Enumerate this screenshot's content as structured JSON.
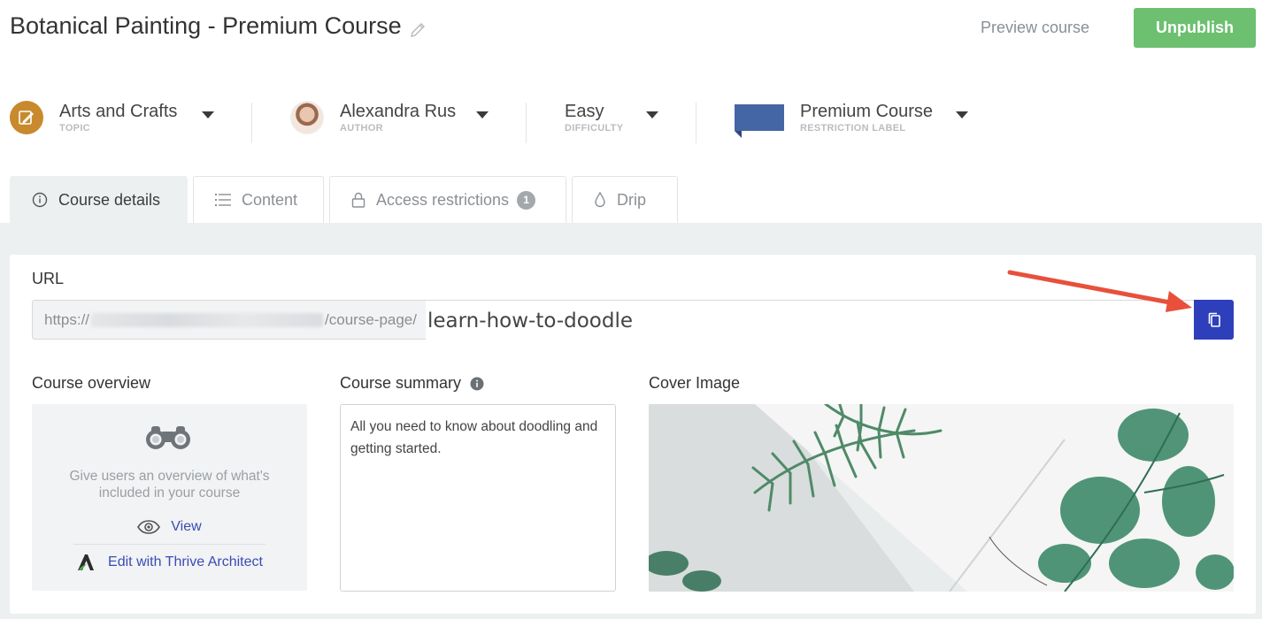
{
  "header": {
    "title": "Botanical Painting - Premium Course",
    "preview_label": "Preview course",
    "unpublish_label": "Unpublish"
  },
  "meta": {
    "topic": {
      "value": "Arts and Crafts",
      "label": "TOPIC",
      "icon": "paintbrush-icon"
    },
    "author": {
      "value": "Alexandra Rus",
      "label": "AUTHOR"
    },
    "difficulty": {
      "value": "Easy",
      "label": "DIFFICULTY"
    },
    "restriction": {
      "value": "Premium Course",
      "label": "RESTRICTION LABEL",
      "color": "#4566a4"
    }
  },
  "tabs": [
    {
      "label": "Course details",
      "icon": "info-icon",
      "active": true
    },
    {
      "label": "Content",
      "icon": "list-icon"
    },
    {
      "label": "Access restrictions",
      "icon": "lock-icon",
      "badge": "1"
    },
    {
      "label": "Drip",
      "icon": "drop-icon"
    }
  ],
  "url": {
    "label": "URL",
    "prefix": "https://",
    "path": "/course-page/",
    "slug": "learn-how-to-doodle"
  },
  "overview": {
    "label": "Course overview",
    "text": "Give users an overview of what's included in your course",
    "view_label": "View",
    "edit_label": "Edit with Thrive Architect"
  },
  "summary": {
    "label": "Course summary",
    "text": "All you need to know about doodling and getting started."
  },
  "cover": {
    "label": "Cover Image"
  },
  "colors": {
    "accent": "#2d3fbb",
    "publish_green": "#6cc070",
    "arrow": "#e8503c"
  }
}
